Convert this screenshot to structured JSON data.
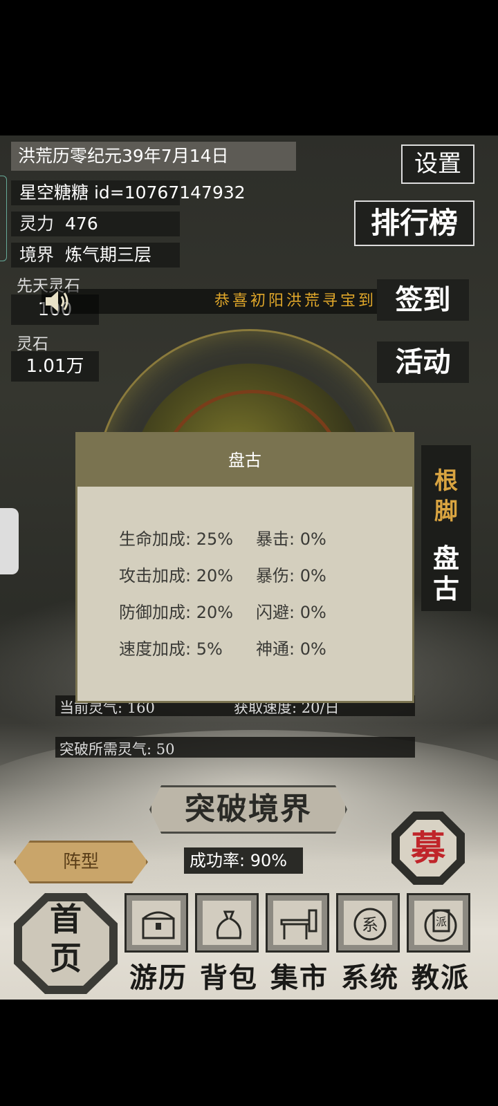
{
  "header": {
    "date": "洪荒历零纪元39年7月14日",
    "player_name": "星空糖糖 id=10767147932",
    "spirit_power_label": "灵力",
    "spirit_power_value": "476",
    "realm_label": "境界",
    "realm_value": "炼气期三层",
    "innate_stone_label": "先天灵石",
    "innate_stone_value": "100",
    "stone_label": "灵石",
    "stone_value": "1.01万"
  },
  "buttons": {
    "settings": "设置",
    "ranking": "排行榜",
    "sign_in": "签到",
    "events": "活动",
    "breakthrough": "突破境界",
    "formation": "阵型",
    "recruit": "募"
  },
  "marquee": "恭喜初阳洪荒寻宝到",
  "root_panel": {
    "title_line1": "根",
    "title_line2": "脚",
    "value_line1": "盘",
    "value_line2": "古"
  },
  "qi": {
    "current": "当前灵气: 160",
    "speed": "获取速度: 20/日",
    "required": "突破所需灵气: 50",
    "success_rate": "成功率: 90%"
  },
  "dialog": {
    "title": "盘古",
    "stats": [
      {
        "left": "生命加成: 25%",
        "right": "暴击: 0%"
      },
      {
        "left": "攻击加成: 20%",
        "right": "暴伤: 0%"
      },
      {
        "left": "防御加成: 20%",
        "right": "闪避: 0%"
      },
      {
        "left": "速度加成: 5%",
        "right": "神通: 0%"
      }
    ]
  },
  "nav": {
    "home_line1": "首",
    "home_line2": "页",
    "items": [
      "游历",
      "背包",
      "集市",
      "系统",
      "教派"
    ]
  },
  "icons": [
    "speaker-icon",
    "chest-icon",
    "bag-icon",
    "market-stall-icon",
    "system-seal-icon",
    "sect-banner-icon"
  ]
}
